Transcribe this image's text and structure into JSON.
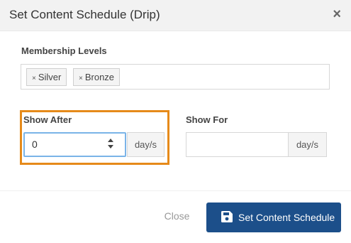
{
  "modal": {
    "title": "Set Content Schedule (Drip)",
    "close_glyph": "×"
  },
  "membership": {
    "label": "Membership Levels",
    "tags": [
      {
        "remove_glyph": "×",
        "label": "Silver"
      },
      {
        "remove_glyph": "×",
        "label": "Bronze"
      }
    ]
  },
  "show_after": {
    "label": "Show After",
    "value": "0",
    "unit": "day/s"
  },
  "show_for": {
    "label": "Show For",
    "value": "",
    "unit": "day/s"
  },
  "footer": {
    "close_label": "Close",
    "submit_label": "Set Content Schedule",
    "submit_icon": "save-icon"
  },
  "colors": {
    "primary": "#1c4f8a",
    "highlight": "#e68a1a",
    "focus": "#7ab4e8"
  }
}
